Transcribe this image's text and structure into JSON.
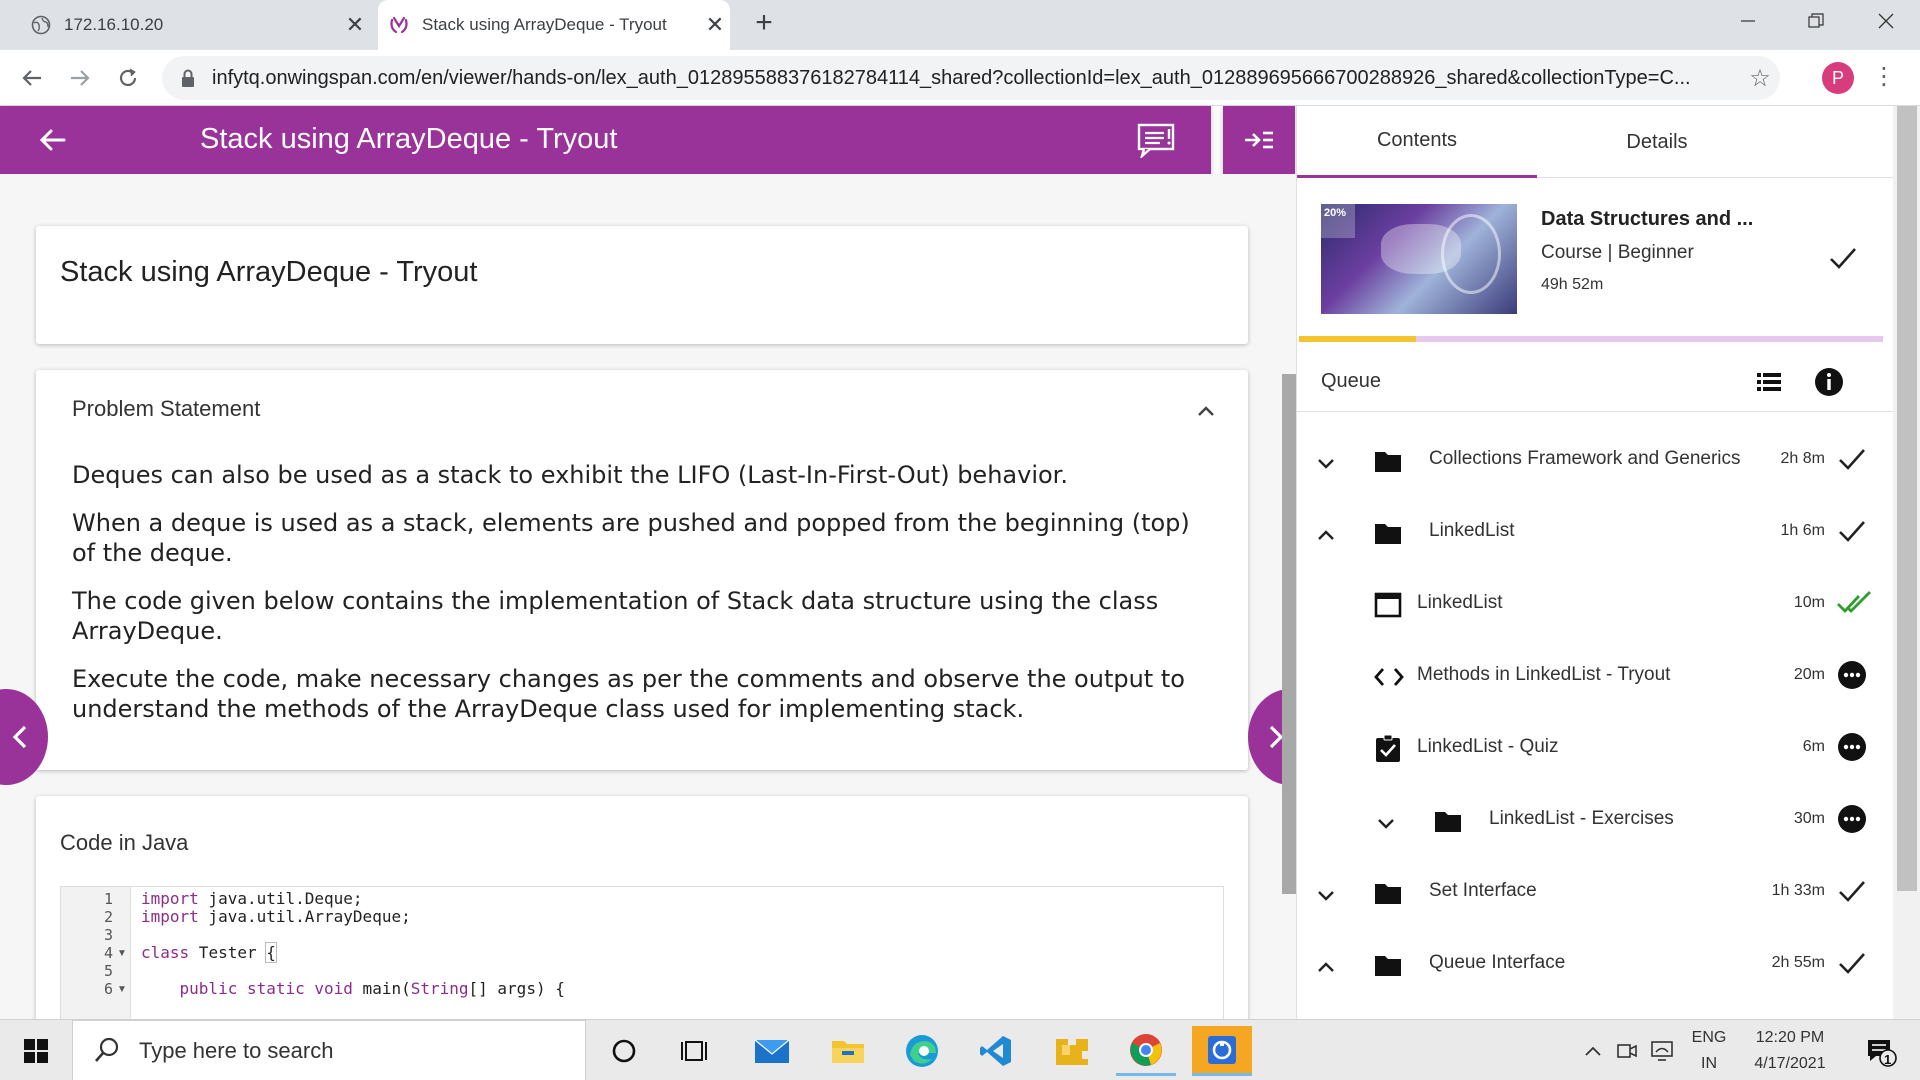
{
  "browser": {
    "tabs": [
      {
        "title": "172.16.10.20",
        "active": false
      },
      {
        "title": "Stack using ArrayDeque - Tryout",
        "active": true
      }
    ],
    "url": "infytq.onwingspan.com/en/viewer/hands-on/lex_auth_012895588376182784114_shared?collectionId=lex_auth_012889695666700288926_shared&collectionType=C...",
    "profile_initial": "P"
  },
  "header": {
    "title": "Stack using ArrayDeque - Tryout"
  },
  "content": {
    "card_title": "Stack using ArrayDeque - Tryout",
    "problem": {
      "heading": "Problem Statement",
      "paragraphs": [
        "Deques can also be used as a stack to exhibit the LIFO (Last-In-First-Out) behavior.",
        "When a deque is used as a stack, elements are pushed and popped from the beginning (top) of the deque.",
        "The code given below contains the implementation of Stack data structure using the class ArrayDeque.",
        "Execute the code, make necessary changes as per the comments and observe the output to understand the methods of the ArrayDeque class used for implementing stack."
      ]
    },
    "code": {
      "heading": "Code in Java",
      "line_numbers": [
        "1",
        "2",
        "3",
        "4",
        "5",
        "6"
      ],
      "lines": {
        "l1_kw": "import",
        "l1_rest": " java.util.Deque;",
        "l2_kw": "import",
        "l2_rest": " java.util.ArrayDeque;",
        "l4_kw": "class",
        "l4_name": " Tester ",
        "l4_brace": "{",
        "l6_kw": "    public static void",
        "l6_name": " main(",
        "l6_type": "String",
        "l6_rest": "[] args) {"
      }
    }
  },
  "sidebar": {
    "tabs": {
      "contents": "Contents",
      "details": "Details"
    },
    "course": {
      "title": "Data Structures and ...",
      "meta": "Course |  Beginner",
      "duration": "49h 52m",
      "thumb_badge": "20%",
      "progress": 0.2
    },
    "queue_label": "Queue",
    "items": [
      {
        "label": "Collections Framework and Generics",
        "duration": "2h 8m",
        "icon": "folder-icon",
        "chevron": "down",
        "status": "done"
      },
      {
        "label": "LinkedList",
        "duration": "1h 6m",
        "icon": "folder-icon",
        "chevron": "up",
        "status": "done"
      },
      {
        "label": "LinkedList",
        "duration": "10m",
        "icon": "resource-icon",
        "chevron": "",
        "status": "completed"
      },
      {
        "label": "Methods in LinkedList - Tryout",
        "duration": "20m",
        "icon": "code-icon",
        "chevron": "",
        "status": "pending"
      },
      {
        "label": "LinkedList - Quiz",
        "duration": "6m",
        "icon": "quiz-icon",
        "chevron": "",
        "status": "pending"
      },
      {
        "label": "LinkedList - Exercises",
        "duration": "30m",
        "icon": "folder-icon",
        "chevron": "down",
        "status": "pending"
      },
      {
        "label": "Set Interface",
        "duration": "1h 33m",
        "icon": "folder-icon",
        "chevron": "down",
        "status": "done"
      },
      {
        "label": "Queue Interface",
        "duration": "2h 55m",
        "icon": "folder-icon",
        "chevron": "up",
        "status": "done"
      }
    ]
  },
  "taskbar": {
    "search_placeholder": "Type here to search",
    "lang_top": "ENG",
    "lang_bottom": "IN",
    "time": "12:20 PM",
    "date": "4/17/2021",
    "notification_count": "1"
  },
  "colors": {
    "accent": "#993399",
    "progress": "#f4c430",
    "check_green": "#2e9e2e"
  }
}
